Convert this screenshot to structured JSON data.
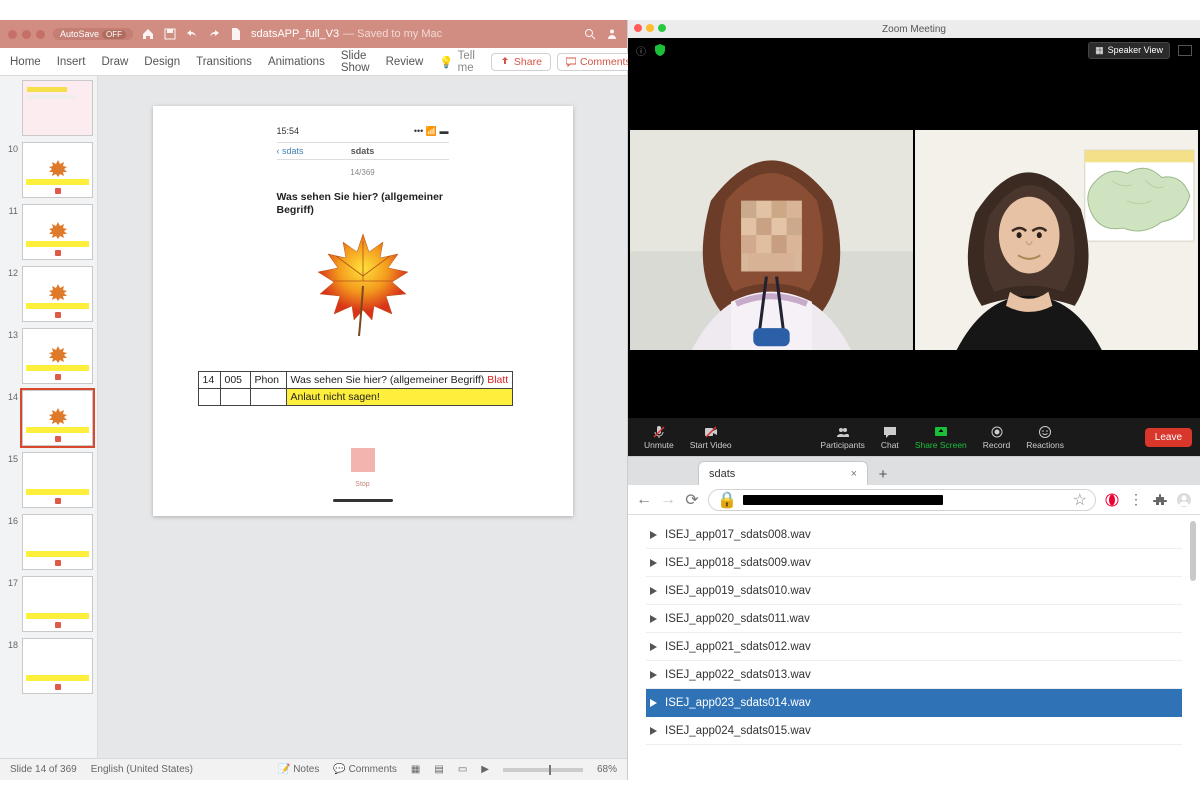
{
  "ppt": {
    "autosave_label": "AutoSave",
    "autosave_state": "OFF",
    "filename": "sdatsAPP_full_V3",
    "filename_suffix": "— Saved to my Mac",
    "tabs": [
      "Home",
      "Insert",
      "Draw",
      "Design",
      "Transitions",
      "Animations",
      "Slide Show",
      "Review"
    ],
    "tellme": "Tell me",
    "share": "Share",
    "comments": "Comments",
    "thumbs": [
      {
        "n": ""
      },
      {
        "n": "10"
      },
      {
        "n": "11"
      },
      {
        "n": "12"
      },
      {
        "n": "13"
      },
      {
        "n": "14"
      },
      {
        "n": "15"
      },
      {
        "n": "16"
      },
      {
        "n": "17"
      },
      {
        "n": "18"
      }
    ],
    "selected_thumb": 5,
    "status": {
      "slide": "Slide 14 of 369",
      "lang": "English (United States)",
      "notes": "Notes",
      "comments": "Comments",
      "zoom": "68%"
    }
  },
  "slide": {
    "phone_time": "15:54",
    "back_label": "sdats",
    "appbar_title": "sdats",
    "counter": "14/369",
    "question": "Was sehen Sie hier? (allgemeiner Begriff)",
    "table": {
      "num1": "14",
      "num2": "005",
      "cat": "Phon",
      "prompt": "Was sehen Sie hier? (allgemeiner Begriff)",
      "answer": "Blatt",
      "note": "Anlaut nicht sagen!"
    },
    "stop": "Stop"
  },
  "zoom": {
    "window_title": "Zoom Meeting",
    "speaker_view": "Speaker View",
    "toolbar": {
      "unmute": "Unmute",
      "start_video": "Start Video",
      "participants": "Participants",
      "chat": "Chat",
      "share": "Share Screen",
      "record": "Record",
      "reactions": "Reactions",
      "leave": "Leave"
    }
  },
  "browser": {
    "tab_title": "sdats",
    "files": [
      "ISEJ_app017_sdats008.wav",
      "ISEJ_app018_sdats009.wav",
      "ISEJ_app019_sdats010.wav",
      "ISEJ_app020_sdats011.wav",
      "ISEJ_app021_sdats012.wav",
      "ISEJ_app022_sdats013.wav",
      "ISEJ_app023_sdats014.wav",
      "ISEJ_app024_sdats015.wav"
    ],
    "selected_index": 6
  }
}
